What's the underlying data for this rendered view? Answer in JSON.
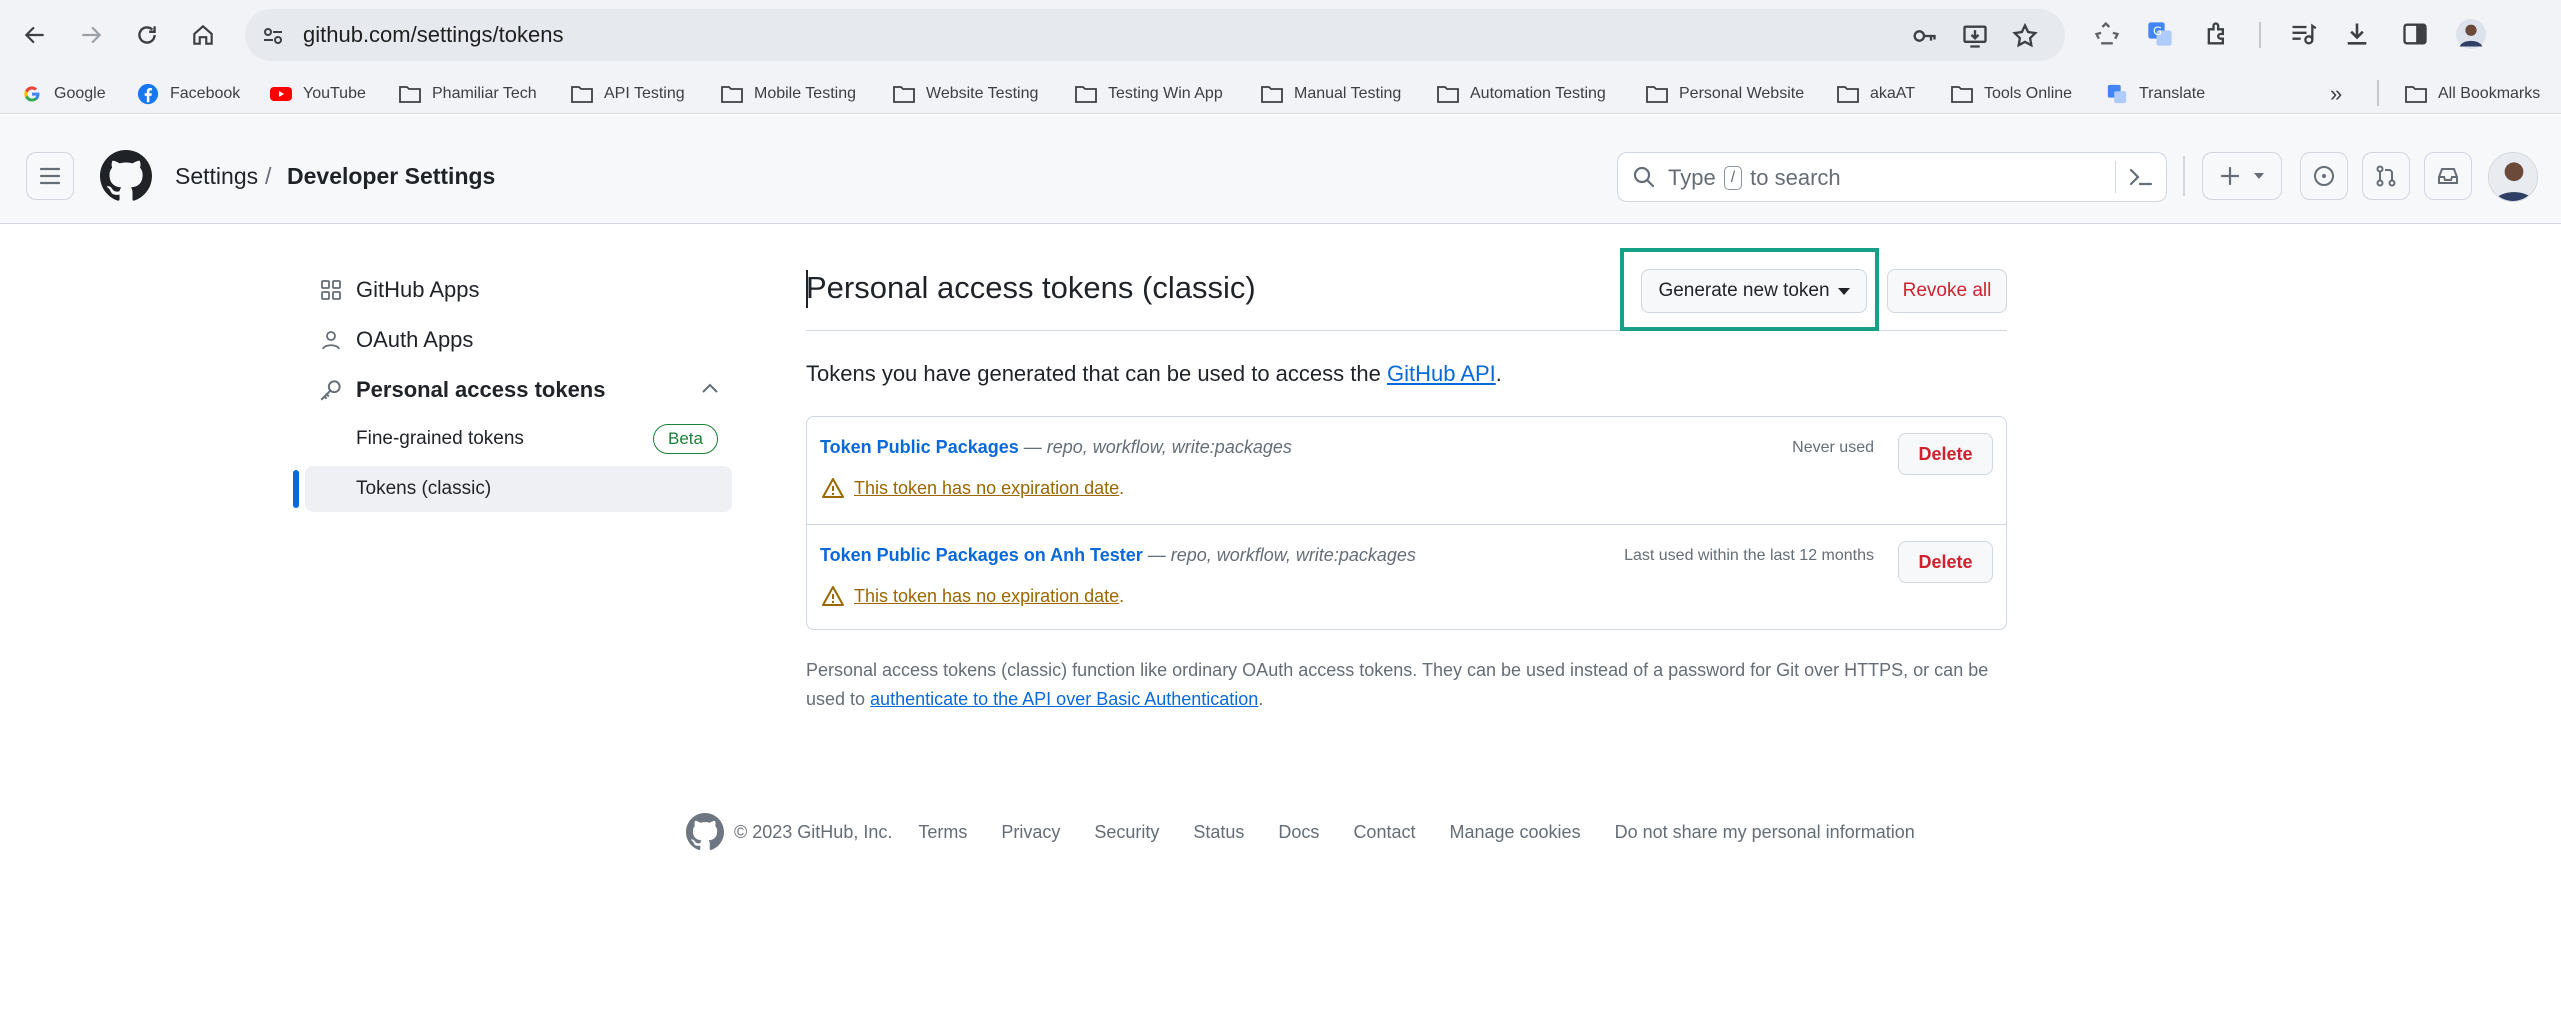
{
  "browser": {
    "url": "github.com/settings/tokens",
    "bookmarks": [
      {
        "label": "Google",
        "icon": "google-icon"
      },
      {
        "label": "Facebook",
        "icon": "facebook-icon"
      },
      {
        "label": "YouTube",
        "icon": "youtube-icon"
      },
      {
        "label": "Phamiliar Tech",
        "icon": "folder-icon"
      },
      {
        "label": "API Testing",
        "icon": "folder-icon"
      },
      {
        "label": "Mobile Testing",
        "icon": "folder-icon"
      },
      {
        "label": "Website Testing",
        "icon": "folder-icon"
      },
      {
        "label": "Testing Win App",
        "icon": "folder-icon"
      },
      {
        "label": "Manual Testing",
        "icon": "folder-icon"
      },
      {
        "label": "Automation Testing",
        "icon": "folder-icon"
      },
      {
        "label": "Personal Website",
        "icon": "folder-icon"
      },
      {
        "label": "akaAT",
        "icon": "folder-icon"
      },
      {
        "label": "Tools Online",
        "icon": "folder-icon"
      },
      {
        "label": "Translate",
        "icon": "translate-icon"
      }
    ],
    "all_bookmarks": "All Bookmarks",
    "more_chevron": "»"
  },
  "header": {
    "crumb_settings": "Settings",
    "crumb_separator": "/",
    "crumb_current": "Developer Settings",
    "search_prefix": "Type",
    "search_key": "/",
    "search_suffix": "to search"
  },
  "sidebar": {
    "github_apps": "GitHub Apps",
    "oauth_apps": "OAuth Apps",
    "personal_access_tokens": "Personal access tokens",
    "fine_grained": "Fine-grained tokens",
    "fine_grained_badge": "Beta",
    "classic": "Tokens (classic)"
  },
  "main": {
    "title": "Personal access tokens (classic)",
    "generate_button": "Generate new token",
    "revoke_button": "Revoke all",
    "intro_text": "Tokens you have generated that can be used to access the ",
    "intro_link": "GitHub API",
    "intro_end": ".",
    "tokens": [
      {
        "name": "Token Public Packages",
        "scopes": " — repo, workflow, write:packages",
        "warning": "This token has no expiration date",
        "warning_end": ".",
        "usage": "Never used",
        "delete_label": "Delete"
      },
      {
        "name": "Token Public Packages on Anh Tester",
        "scopes": " — repo, workflow, write:packages",
        "warning": "This token has no expiration date",
        "warning_end": ".",
        "usage": "Last used within the last 12 months",
        "delete_label": "Delete"
      }
    ],
    "note_text": "Personal access tokens (classic) function like ordinary OAuth access tokens. They can be used instead of a password for Git over HTTPS, or can be used to ",
    "note_link": "authenticate to the API over Basic Authentication",
    "note_end": "."
  },
  "footer": {
    "copyright": "© 2023 GitHub, Inc.",
    "links": [
      "Terms",
      "Privacy",
      "Security",
      "Status",
      "Docs",
      "Contact",
      "Manage cookies",
      "Do not share my personal information"
    ]
  },
  "colors": {
    "link": "#0969da",
    "danger": "#cf222e",
    "warning": "#9a6700",
    "success": "#1a7f37",
    "highlight": "#16a085"
  }
}
